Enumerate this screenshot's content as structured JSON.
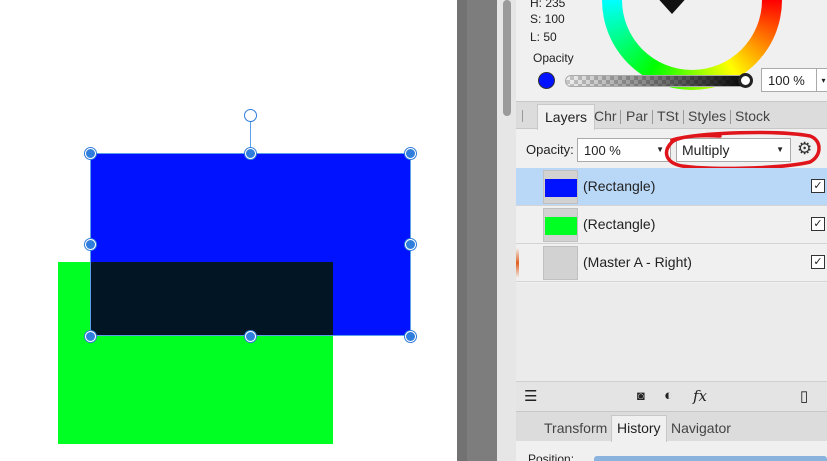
{
  "color_panel": {
    "hue_line": "H: 235",
    "saturation_line": "S: 100",
    "lightness_line": "L: 50",
    "opacity_label": "Opacity",
    "opacity_value": "100 %",
    "fill_color": "#0012ff"
  },
  "tabs": {
    "items": [
      "Layers",
      "Chr",
      "Par",
      "TSt",
      "Styles",
      "Stock"
    ],
    "active": "Layers"
  },
  "layers_panel": {
    "opacity_label": "Opacity:",
    "opacity_value": "100 %",
    "blend_mode": "Multiply",
    "layers": [
      {
        "name": "(Rectangle)",
        "color": "#0012ff",
        "selected": true,
        "visible": true
      },
      {
        "name": "(Rectangle)",
        "color": "#00ff22",
        "selected": false,
        "visible": true
      },
      {
        "name": "(Master A - Right)",
        "color": "",
        "selected": false,
        "visible": true
      }
    ]
  },
  "bottom_tabs": {
    "items": [
      "Transform",
      "History",
      "Navigator"
    ],
    "active": "History",
    "position_label": "Position:"
  },
  "canvas": {
    "blue_rect_color": "#0012ff",
    "green_rect_color": "#00ff22",
    "overlap_color": "#011524"
  }
}
